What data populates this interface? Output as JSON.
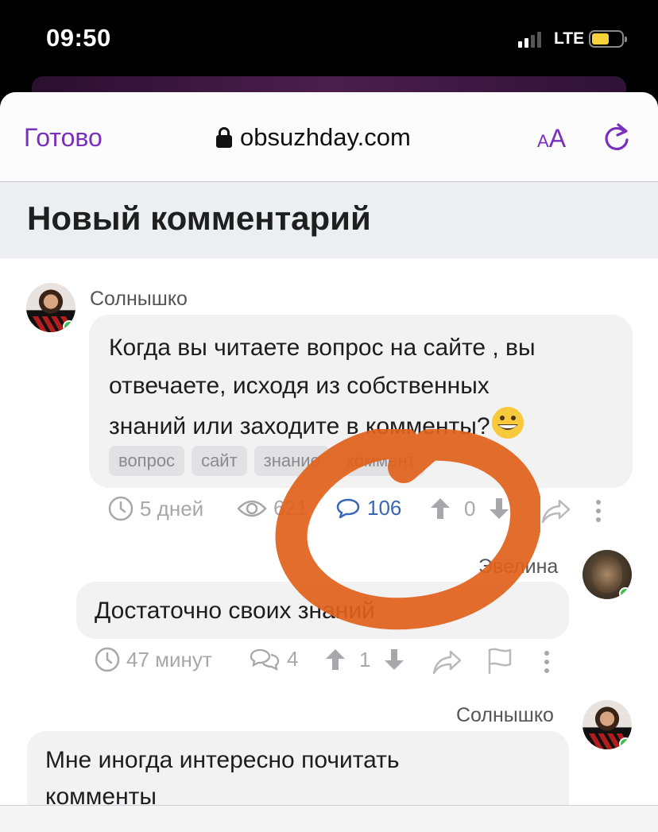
{
  "status_bar": {
    "time": "09:50",
    "network": "LTE",
    "battery_level": 0.55
  },
  "browser": {
    "done_label": "Готово",
    "url": "obsuzhday.com",
    "text_size_small": "A",
    "text_size_large": "A"
  },
  "page": {
    "title": "Новый комментарий"
  },
  "question": {
    "author": "Солнышко",
    "lines": [
      "Когда вы читаете вопрос на сайте , вы",
      "отвечаете, исходя из собственных",
      "знаний или заходите в комменты?"
    ],
    "tags": [
      "вопрос",
      "сайт",
      "знание",
      "коммент"
    ],
    "time": "5 дней",
    "views": "621",
    "comments": "106",
    "votes": "0"
  },
  "reply1": {
    "author": "Эвелина",
    "text": "Достаточно своих знаний",
    "time": "47 минут",
    "replies": "4",
    "votes": "1"
  },
  "reply2": {
    "author": "Солнышко",
    "line1": "Мне иногда интересно почитать",
    "line2": "комменты"
  },
  "colors": {
    "accent": "#7b2fbe",
    "link": "#3a66b5",
    "online": "#3cc14e",
    "annotation": "#e0611a"
  }
}
